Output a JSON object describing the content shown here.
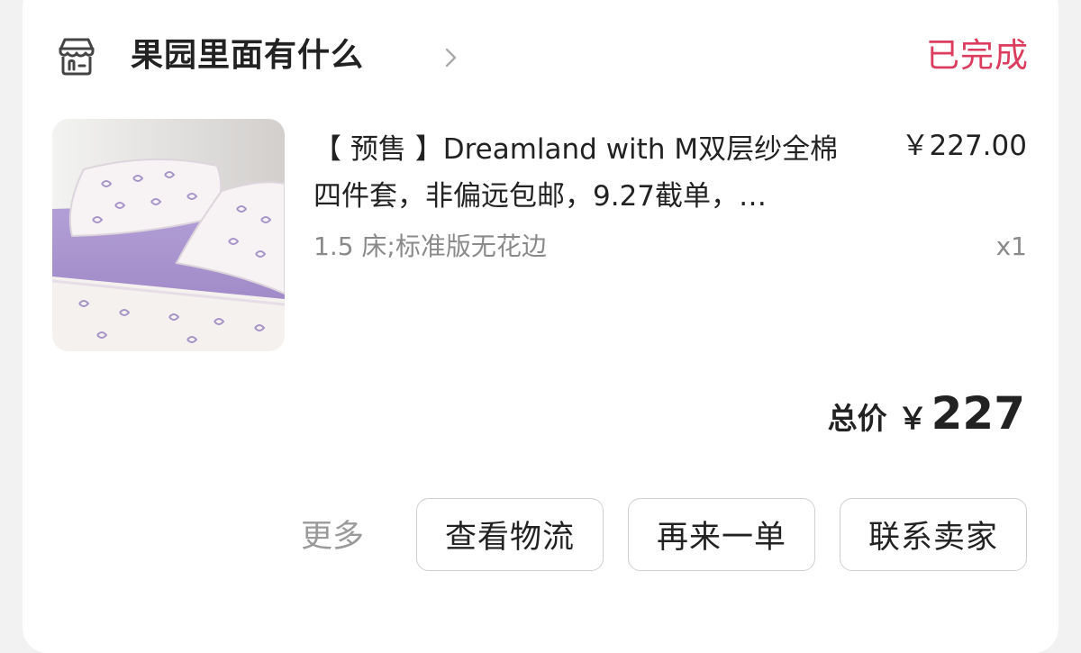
{
  "order": {
    "shop_name": "果园里面有什么",
    "status": "已完成",
    "colors": {
      "status": "#dc3d5e",
      "text": "#222222",
      "muted": "#8a8a8a"
    }
  },
  "product": {
    "title": "【 预售 】Dreamland with M双层纱全棉四件套，非偏远包邮，9.27截单，…",
    "price": "￥227.00",
    "spec": "1.5 床;标准版无花边",
    "quantity": "x1",
    "image_icon": "lavender-bedding-photo"
  },
  "summary": {
    "label": "总价",
    "currency": "￥",
    "value": "227"
  },
  "actions": {
    "more": "更多",
    "buttons": [
      "查看物流",
      "再来一单",
      "联系卖家"
    ]
  },
  "icons": {
    "shop": "shop-icon",
    "chevron": "chevron-right-icon"
  }
}
